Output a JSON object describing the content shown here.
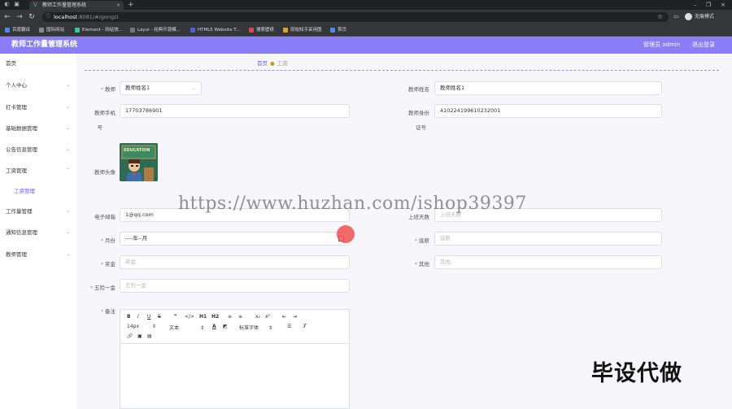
{
  "browser": {
    "tab_title": "教师工作量管理系统",
    "url_host": "localhost",
    "url_path": ":8081/#/gongzi",
    "profile_label": "无痕模式",
    "bookmarks": [
      "百度翻译",
      "国际网站",
      "Element - 网站快...",
      "Layui - 经典开源模...",
      "HTML5 Website T...",
      "搜索壁纸",
      "原始知乎采用图",
      "首页"
    ]
  },
  "header": {
    "title": "教师工作量管理系统",
    "user": "管理员 admin",
    "logout": "退出登录"
  },
  "sidebar": {
    "items": [
      {
        "label": "首页"
      },
      {
        "label": "个人中心"
      },
      {
        "label": "打卡管理"
      },
      {
        "label": "基础数据管理"
      },
      {
        "label": "公告信息管理"
      },
      {
        "label": "工资管理"
      },
      {
        "label": "工资管理"
      },
      {
        "label": "工作量管理"
      },
      {
        "label": "通知信息管理"
      },
      {
        "label": "教师管理"
      }
    ]
  },
  "breadcrumb": {
    "home": "首页",
    "current": "工资"
  },
  "form": {
    "teacher_label": "教师",
    "teacher_value": "教师姓名1",
    "teacher_name_label": "教师姓名",
    "teacher_name_value": "教师姓名1",
    "phone_label_1": "教师手机",
    "phone_label_2": "号",
    "phone_value": "17703786901",
    "id_label_1": "教师身份",
    "id_label_2": "证号",
    "id_value": "410224199610232001",
    "avatar_label": "教师头像",
    "avatar_text": "EDUCATION",
    "email_label": "电子邮箱",
    "email_value": "1@qq.com",
    "workday_label": "上班天数",
    "workday_placeholder": "上班天数",
    "month_label": "月份",
    "month_value": "----年--月",
    "salary_label": "底薪",
    "salary_placeholder": "底薪",
    "bonus_label": "奖金",
    "bonus_placeholder": "奖金",
    "other_label": "其他",
    "other_placeholder": "其他",
    "insurance_label": "五险一金",
    "insurance_placeholder": "五险一金",
    "remark_label": "备注"
  },
  "editor": {
    "row1": [
      "B",
      "I",
      "U",
      "S",
      "❞",
      "</>",
      "H1",
      "H2",
      "≡",
      "≡",
      "x₂",
      "x²",
      "⇤",
      "⇥"
    ],
    "font_size": "14px",
    "text_style": "文本",
    "font_family": "标准字体"
  },
  "overlay": {
    "watermark": "https://www.huzhan.com/ishop39397",
    "badge": "毕设代做"
  }
}
